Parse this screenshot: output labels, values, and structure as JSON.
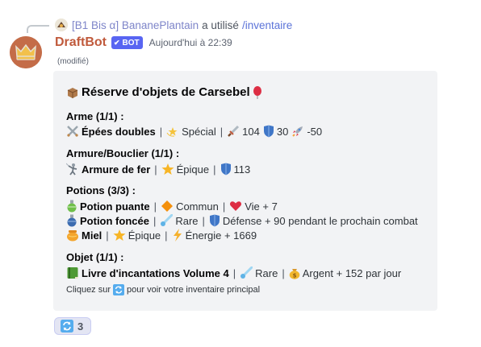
{
  "reply": {
    "user": "[B1 Bis α] BananePlantain",
    "verb": "a utilisé",
    "command": "/inventaire"
  },
  "message": {
    "author": "DraftBot",
    "bot_tag": "BOT",
    "timestamp": "Aujourd'hui à 22:39",
    "edited": "(modifié)"
  },
  "embed": {
    "title": "Réserve d'objets de Carsebel",
    "sections": {
      "weapon": {
        "header": "Arme (1/1) :",
        "name": "Épées doubles",
        "rarity": "Spécial",
        "attack": "104",
        "defense": "30",
        "speed": "-50"
      },
      "armor": {
        "header": "Armure/Bouclier (1/1) :",
        "name": "Armure de fer",
        "rarity": "Épique",
        "defense": "113"
      },
      "potions": {
        "header": "Potions (3/3) :",
        "items": [
          {
            "name": "Potion puante",
            "rarity": "Commun",
            "effect": "Vie + 7"
          },
          {
            "name": "Potion foncée",
            "rarity": "Rare",
            "effect": "Défense + 90 pendant le prochain combat"
          },
          {
            "name": "Miel",
            "rarity": "Épique",
            "effect": "Énergie + 1669"
          }
        ]
      },
      "object": {
        "header": "Objet (1/1) :",
        "name": "Livre d'incantations Volume 4",
        "rarity": "Rare",
        "effect": "Argent + 152 par jour"
      }
    },
    "footer_before": "Cliquez sur",
    "footer_after": "pour voir votre inventaire principal"
  },
  "reaction": {
    "icon": "repeat-icon",
    "count": "3"
  },
  "colors": {
    "author": "#c05a3c",
    "bot_tag": "#5865f2",
    "command": "#5b73d8",
    "embed_bg": "#f2f3f5"
  }
}
